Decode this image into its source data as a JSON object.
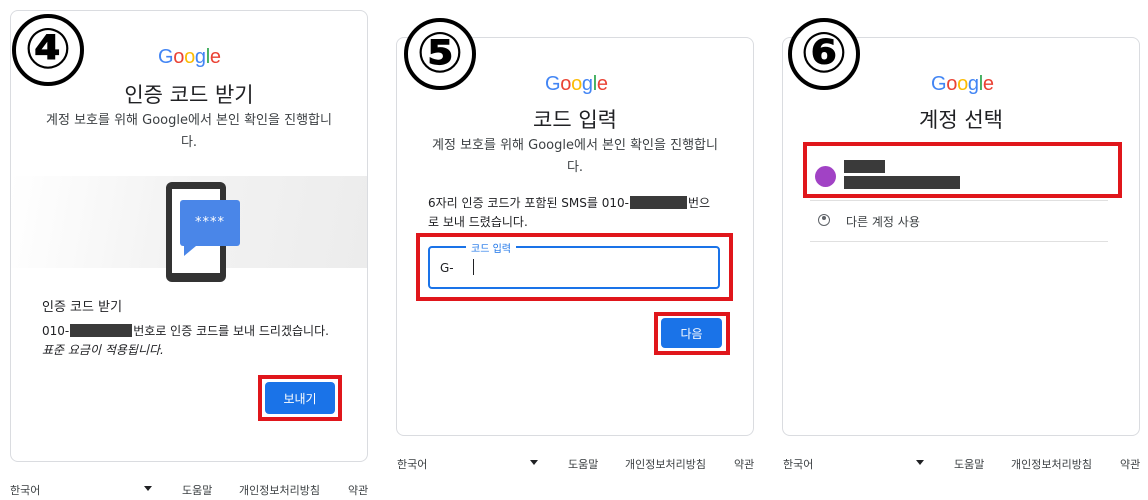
{
  "google_logo": {
    "letters": [
      "G",
      "o",
      "o",
      "g",
      "l",
      "e"
    ],
    "colors": [
      "#4285F4",
      "#EA4335",
      "#FBBC05",
      "#4285F4",
      "#34A853",
      "#EA4335"
    ]
  },
  "panel4": {
    "step": "④",
    "title": "인증 코드 받기",
    "desc_line1": "계정 보호를 위해 Google에서 본인 확인을 진행합니",
    "desc_line2": "다.",
    "phone_stars": "****",
    "section_title": "인증 코드 받기",
    "send_prefix": "010-",
    "send_suffix": "번호로 인증 코드를 보내 드리겠습니다.",
    "rate_note": "표준 요금이 적용됩니다.",
    "send_button": "보내기"
  },
  "panel5": {
    "step": "⑤",
    "title": "코드 입력",
    "desc_line1": "계정 보호를 위해 Google에서 본인 확인을 진행합니",
    "desc_line2": "다.",
    "sms_line1_prefix": "6자리 인증 코드가 포함된 SMS를 010-",
    "sms_line1_suffix": "번으",
    "sms_line2": "로 보내 드렸습니다.",
    "input_label": "코드 입력",
    "input_prefix": "G-",
    "next_button": "다음"
  },
  "panel6": {
    "step": "⑥",
    "title": "계정 선택",
    "other_account": "다른 계정 사용",
    "avatar_color": "#a142c5"
  },
  "footer": {
    "language": "한국어",
    "help": "도움말",
    "privacy": "개인정보처리방침",
    "terms": "약관"
  },
  "accent": {
    "primary": "#1a73e8",
    "highlight": "#e0161b"
  }
}
